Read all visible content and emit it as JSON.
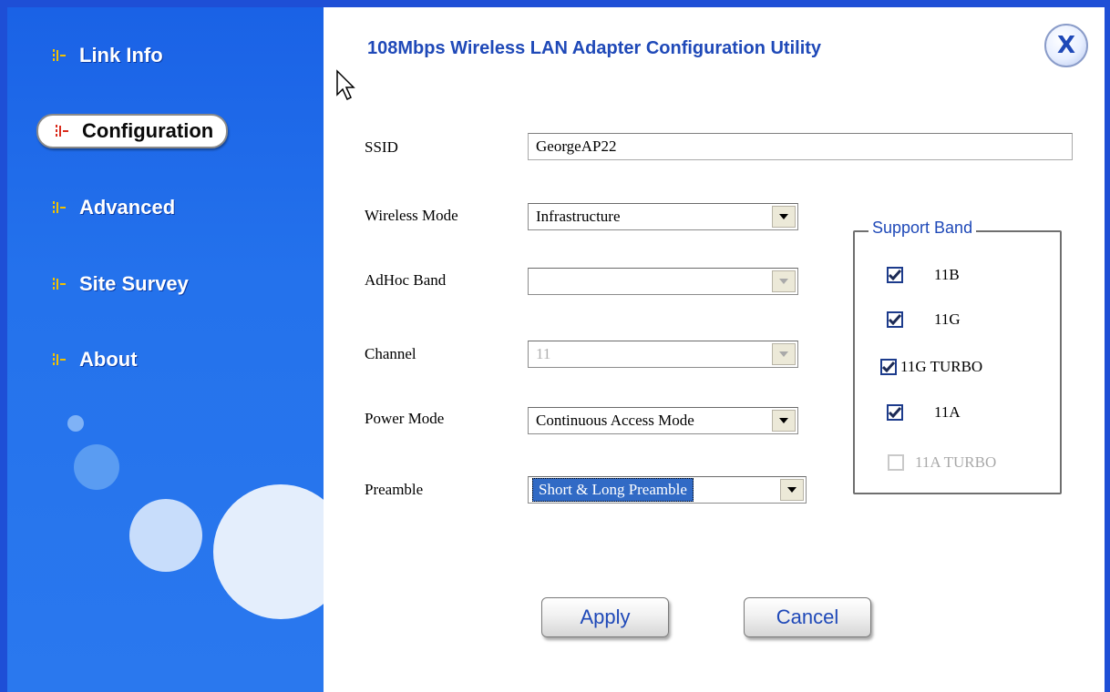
{
  "window": {
    "title": "108Mbps Wireless LAN Adapter Configuration Utility",
    "close_label": "X"
  },
  "sidebar": {
    "items": [
      {
        "label": "Link Info",
        "active": false
      },
      {
        "label": "Configuration",
        "active": true
      },
      {
        "label": "Advanced",
        "active": false
      },
      {
        "label": "Site Survey",
        "active": false
      },
      {
        "label": "About",
        "active": false
      }
    ]
  },
  "form": {
    "ssid": {
      "label": "SSID",
      "value": "GeorgeAP22"
    },
    "wireless_mode": {
      "label": "Wireless Mode",
      "value": "Infrastructure"
    },
    "adhoc_band": {
      "label": "AdHoc Band",
      "value": "",
      "disabled": true
    },
    "channel": {
      "label": "Channel",
      "value": "11",
      "disabled": true
    },
    "power_mode": {
      "label": "Power Mode",
      "value": "Continuous Access Mode"
    },
    "preamble": {
      "label": "Preamble",
      "value": "Short & Long Preamble"
    }
  },
  "support_band": {
    "legend": "Support Band",
    "options": [
      {
        "label": "11B",
        "checked": true,
        "disabled": false
      },
      {
        "label": "11G",
        "checked": true,
        "disabled": false
      },
      {
        "label": "11G TURBO",
        "checked": true,
        "disabled": false
      },
      {
        "label": "11A",
        "checked": true,
        "disabled": false
      },
      {
        "label": "11A TURBO",
        "checked": false,
        "disabled": true
      }
    ]
  },
  "buttons": {
    "apply": "Apply",
    "cancel": "Cancel"
  },
  "colors": {
    "sidebar_blue": "#2472ec",
    "frame_blue": "#1e4fd6",
    "title_blue": "#1f49b8",
    "active_icon_red": "#d92b1c",
    "selection_blue": "#316ac5"
  }
}
